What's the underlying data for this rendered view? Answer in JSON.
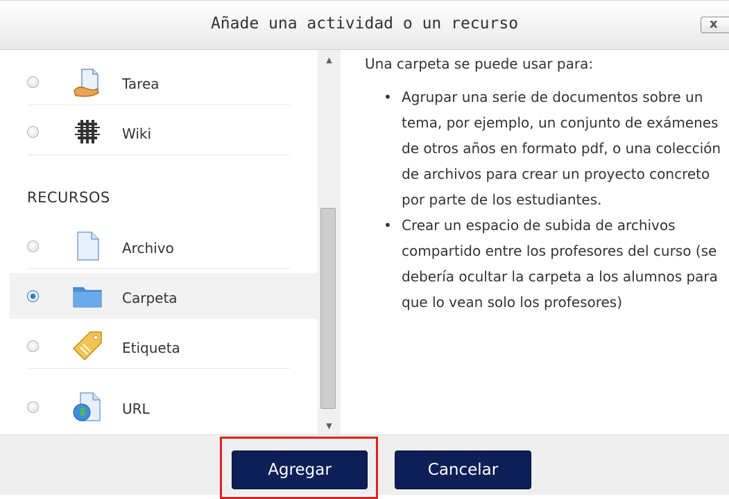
{
  "dialog": {
    "title": "Añade una actividad o un recurso",
    "close_label": "x"
  },
  "options": {
    "activities": [
      {
        "label": "Tarea",
        "icon": "assignment-icon",
        "selected": false
      },
      {
        "label": "Wiki",
        "icon": "wiki-icon",
        "selected": false
      }
    ],
    "resources_heading": "RECURSOS",
    "resources": [
      {
        "label": "Archivo",
        "icon": "file-icon",
        "selected": false
      },
      {
        "label": "Carpeta",
        "icon": "folder-icon",
        "selected": true
      },
      {
        "label": "Etiqueta",
        "icon": "label-icon",
        "selected": false
      },
      {
        "label": "URL",
        "icon": "url-icon",
        "selected": false
      }
    ]
  },
  "description": {
    "intro": "Una carpeta se puede usar para:",
    "bullets": [
      "Agrupar una serie de documentos sobre un tema, por ejemplo, un conjunto de exámenes de otros años en formato pdf, o una colección de archivos para crear un proyecto concreto por parte de los estudiantes.",
      "Crear un espacio de subida de archivos compartido entre los profesores del curso (se debería ocultar la carpeta a los alumnos para que lo vean solo los profesores)"
    ]
  },
  "buttons": {
    "add": "Agregar",
    "cancel": "Cancelar"
  },
  "colors": {
    "button_bg": "#0e1f57",
    "highlight": "#e02020",
    "selected_row": "#f2f2f2"
  }
}
